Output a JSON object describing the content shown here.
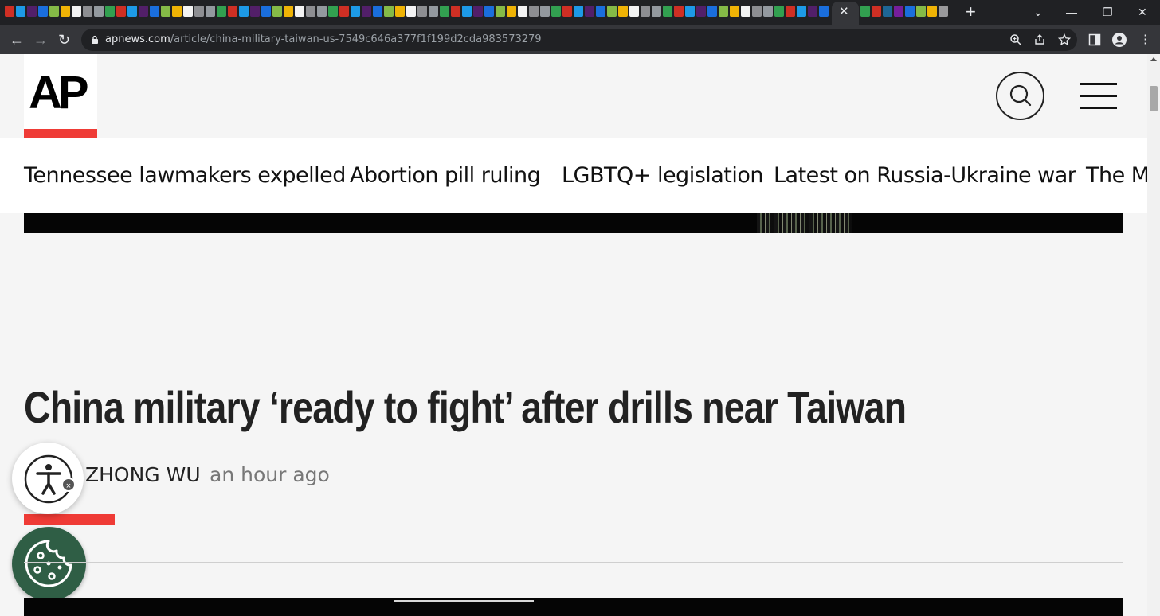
{
  "browser": {
    "active_tab_close": "✕",
    "new_tab": "+",
    "window_controls": {
      "chevron": "⌄",
      "minimize": "—",
      "maximize": "❐",
      "close": "✕"
    },
    "url_host": "apnews.com",
    "url_path": "/article/china-military-taiwan-us-7549c646a377f1f199d2cda983573279",
    "icons": [
      "back-icon",
      "forward-icon",
      "reload-icon",
      "lock-icon",
      "zoom-icon",
      "share-icon",
      "bookmark-star-icon",
      "side-panel-icon",
      "profile-icon",
      "kebab-menu-icon"
    ],
    "favicon_colors": [
      "#d93025",
      "#1a73e8",
      "#ffffff",
      "#34a853",
      "#7b1fa2",
      "#fbbc04",
      "#9aa0a6",
      "#1da1f2",
      "#8bc34a",
      "#e8eaed"
    ]
  },
  "site": {
    "logo_text": "AP",
    "accent_color": "#ef3b36",
    "topics": [
      "Tennessee lawmakers expelled",
      "Abortion pill ruling",
      "LGBTQ+ legislation",
      "Latest on Russia-Ukraine war",
      "The M"
    ]
  },
  "article": {
    "headline": "China military ‘ready to fight’ after drills near Taiwan",
    "byline_visible": "ZHONG WU",
    "timestamp": "an hour ago"
  },
  "widgets": {
    "accessibility_close": "×",
    "cookie_color": "#2f5e45"
  }
}
